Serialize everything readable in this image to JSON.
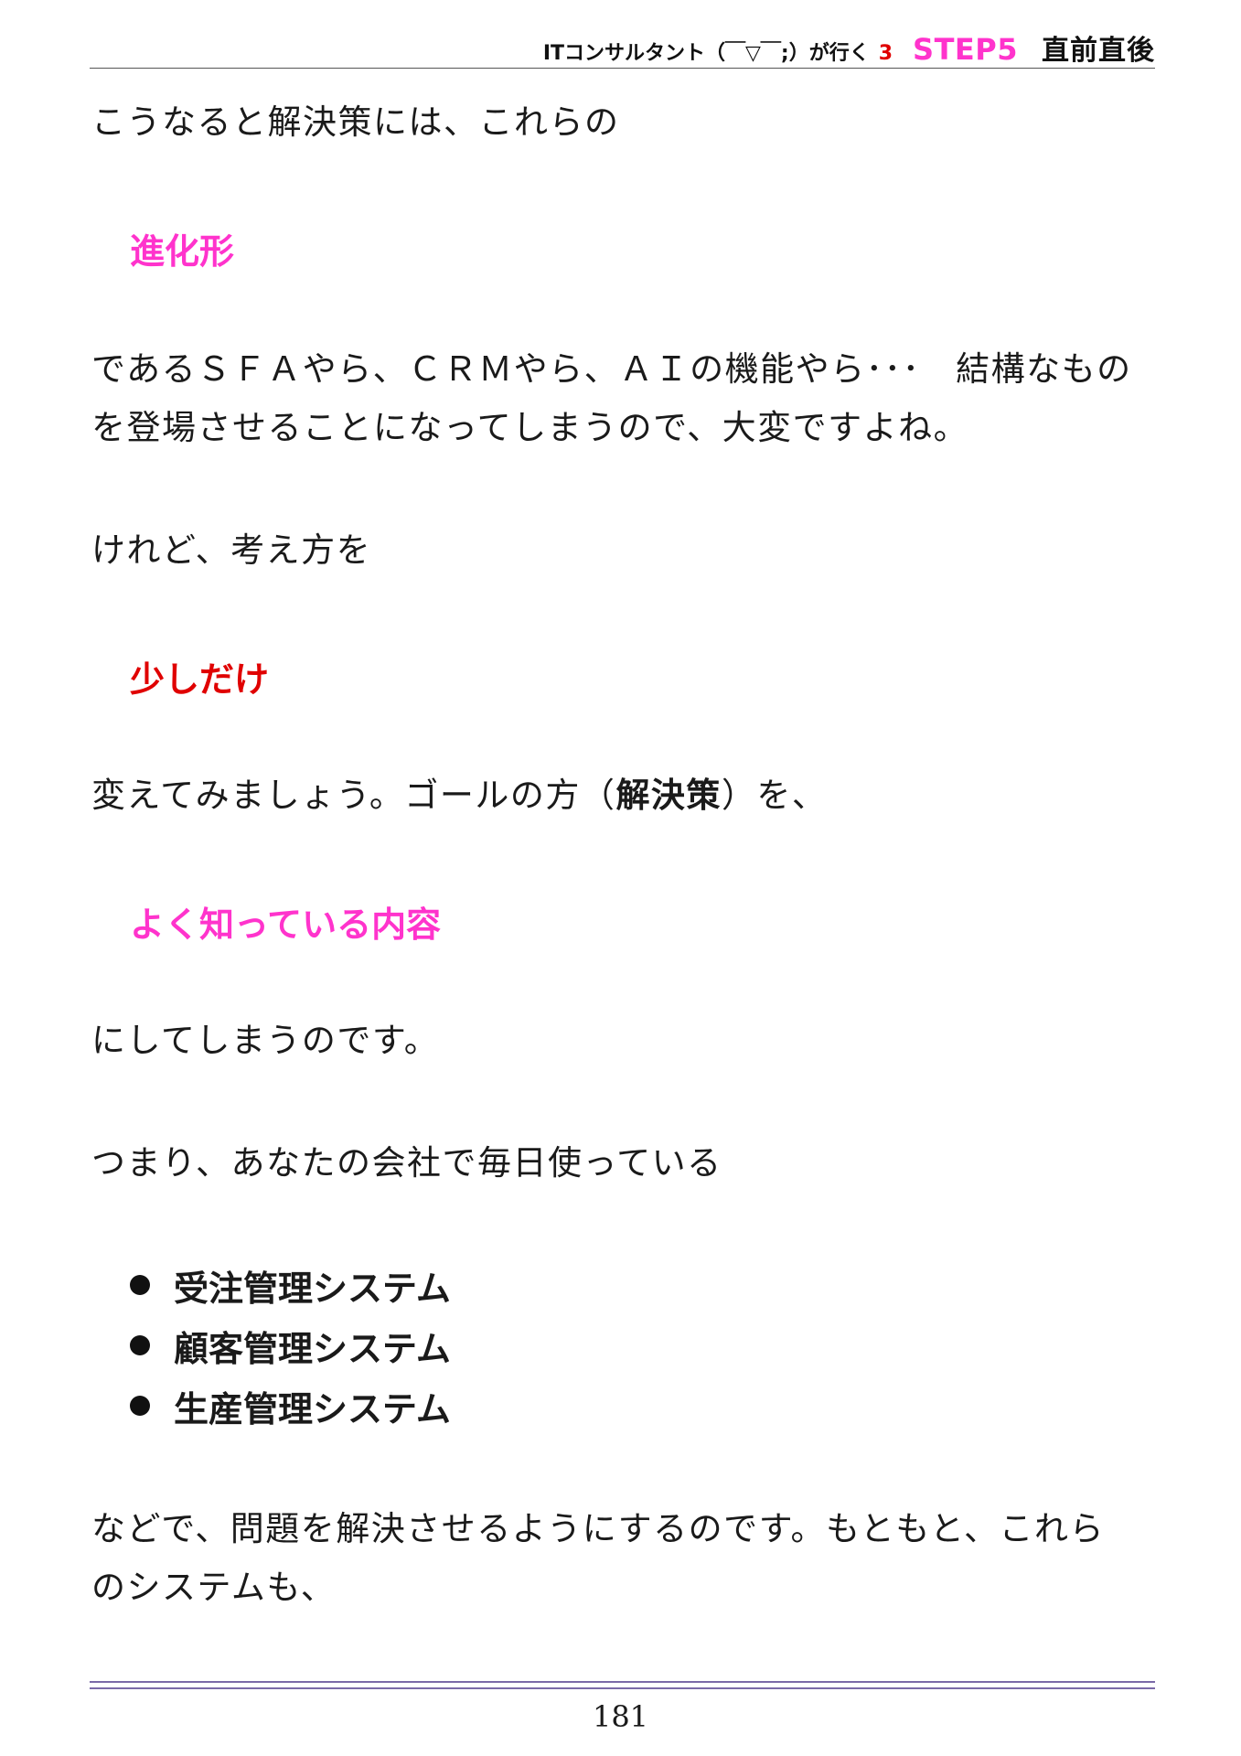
{
  "header": {
    "book_title": "ITコンサルタント（￣▽￣;）が行く",
    "book_number": "3",
    "step_label": "STEP5",
    "section": "直前直後"
  },
  "paragraphs": {
    "p1": "こうなると解決策には、これらの",
    "emph1": "進化形",
    "p2_line1": "であるＳＦＡやら、ＣＲＭやら、ＡＩの機能やら･･･　結構なもの",
    "p2_line2": "を登場させることになってしまうので、大変ですよね。",
    "p3": "けれど、考え方を",
    "emph2": "少しだけ",
    "p4_pre": "変えてみましょう。ゴールの方（",
    "p4_bold": "解決策",
    "p4_post": "）を、",
    "emph3": "よく知っている内容",
    "p5": "にしてしまうのです。",
    "p6": "つまり、あなたの会社で毎日使っている",
    "p7_line1": "などで、問題を解決させるようにするのです。もともと、これら",
    "p7_line2": "のシステムも、"
  },
  "bullets": [
    "受注管理システム",
    "顧客管理システム",
    "生産管理システム"
  ],
  "footer": {
    "page_number": "181"
  },
  "colors": {
    "pink": "#ff33cc",
    "red": "#e00000",
    "rule": "#7a6aa8"
  }
}
